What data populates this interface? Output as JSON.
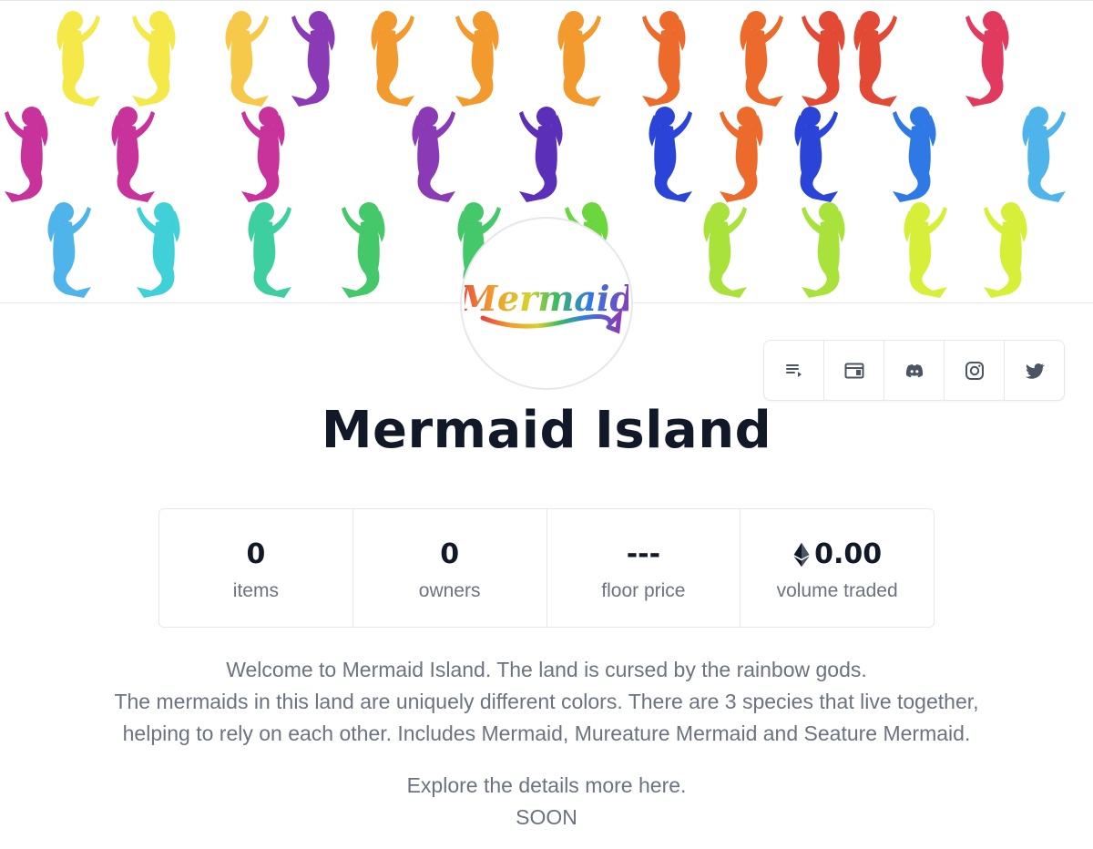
{
  "collection": {
    "title": "Mermaid Island",
    "logo_text": "Mermaid"
  },
  "social": [
    {
      "icon": "activity-icon",
      "label": "Activity"
    },
    {
      "icon": "website-icon",
      "label": "Website"
    },
    {
      "icon": "discord-icon",
      "label": "Discord"
    },
    {
      "icon": "instagram-icon",
      "label": "Instagram"
    },
    {
      "icon": "twitter-icon",
      "label": "Twitter"
    }
  ],
  "stats": [
    {
      "value": "0",
      "label": "items"
    },
    {
      "value": "0",
      "label": "owners"
    },
    {
      "value": "---",
      "label": "floor price"
    },
    {
      "value": "0.00",
      "label": "volume traded",
      "icon": "ethereum-icon"
    }
  ],
  "description": {
    "line1": "Welcome to Mermaid Island. The land is cursed by the rainbow gods.",
    "line2": "The mermaids in this land are uniquely different colors. There are 3 species that live together,",
    "line3": "helping to rely on each other. Includes Mermaid, Mureature Mermaid and Seature Mermaid.",
    "line4": "Explore the details more here.",
    "line5": "SOON"
  },
  "colors": {
    "text_dark": "#111827",
    "text_muted": "#6b7280",
    "border": "#e5e7eb",
    "banner_palette": [
      "#f5e94a",
      "#f7c94a",
      "#f39a2e",
      "#ec6b2c",
      "#e24a36",
      "#e23a5e",
      "#c8339b",
      "#8b3ab5",
      "#5b2fb8",
      "#2a44d8",
      "#2f79e6",
      "#4fb4ea",
      "#3fd0d8",
      "#3dcfa0",
      "#45c86a",
      "#6bd63d",
      "#a8e23a",
      "#d8ef3a"
    ]
  }
}
